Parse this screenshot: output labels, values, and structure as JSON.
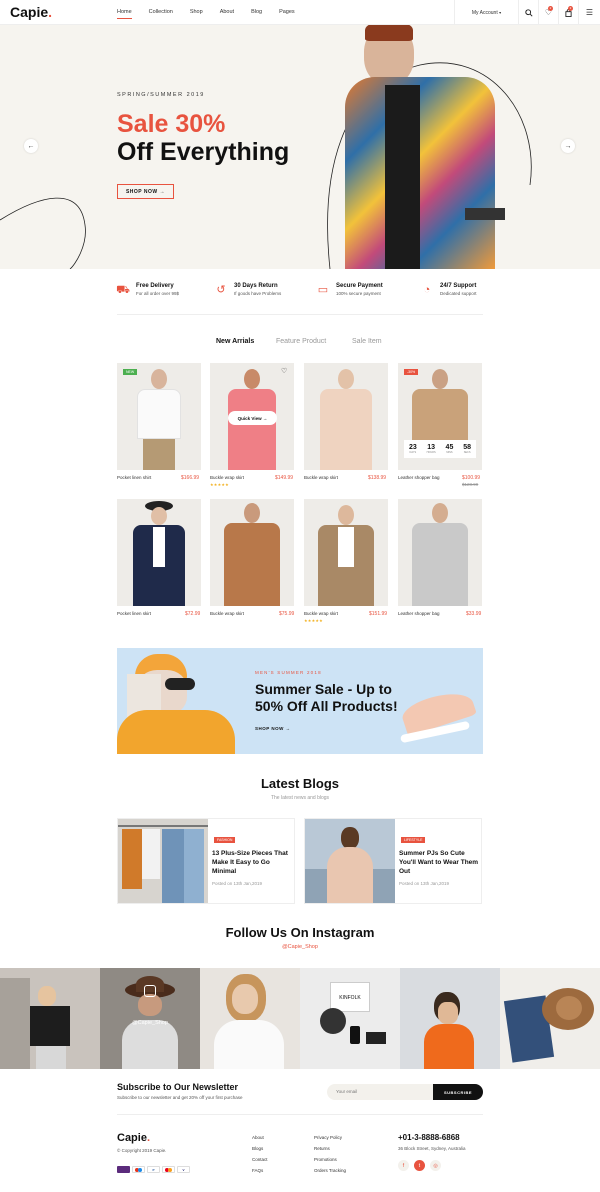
{
  "header": {
    "logo": "Capie",
    "nav": [
      "Home",
      "Collection",
      "Shop",
      "About",
      "Blog",
      "Pages"
    ],
    "account": "My Account",
    "wishlist_count": "2",
    "cart_count": "3"
  },
  "hero": {
    "subtitle": "SPRING/SUMMER 2019",
    "headline_1": "Sale 30%",
    "headline_2": "Off Everything",
    "button": "SHOP NOW →"
  },
  "features": [
    {
      "title": "Free Delivery",
      "text": "For all order over 99$"
    },
    {
      "title": "30 Days Return",
      "text": "If goods have Problems"
    },
    {
      "title": "Secure Payment",
      "text": "100% secure payment"
    },
    {
      "title": "24/7 Support",
      "text": "Dedicated support"
    }
  ],
  "tabs": [
    "New Arrials",
    "Feature Product",
    "Sale Item"
  ],
  "products": [
    {
      "name": "Pocket linen shirt",
      "price": "$166.99",
      "tag": "NEW"
    },
    {
      "name": "Buckle wrap skirt",
      "price": "$149.99",
      "quick_view": "Quick View →"
    },
    {
      "name": "Buckle wrap skirt",
      "price": "$138.99"
    },
    {
      "name": "Leather shopper bag",
      "price": "$100.99",
      "old_price": "$128.99",
      "tag": "-30%"
    },
    {
      "name": "Pocket linen skirt",
      "price": "$72.99"
    },
    {
      "name": "Buckle wrap skirt",
      "price": "$75.99"
    },
    {
      "name": "Buckle wrap skirt",
      "price": "$151.99"
    },
    {
      "name": "Leather shopper bag",
      "price": "$33.99"
    }
  ],
  "countdown": [
    {
      "value": "23",
      "unit": "DAYS"
    },
    {
      "value": "13",
      "unit": "HOURS"
    },
    {
      "value": "45",
      "unit": "MINS"
    },
    {
      "value": "58",
      "unit": "SECS"
    }
  ],
  "banner": {
    "eyebrow": "MEN'S SUMMER 2018",
    "title_1": "Summer Sale - Up to",
    "title_2": "50% Off All Products!",
    "button": "SHOP NOW →"
  },
  "blogs": {
    "title": "Latest Blogs",
    "subtitle": "The latest news and blogs",
    "posts": [
      {
        "tag": "FASHION",
        "title": "13 Plus-Size Pieces That Make It Easy to Go Minimal",
        "date": "Posted on 13th Jan,2019"
      },
      {
        "tag": "LIFESTYLE",
        "title": "Summer PJs So Cute You'll Want to Wear Them Out",
        "date": "Posted on 13th Jan,2019"
      }
    ]
  },
  "instagram": {
    "title": "Follow Us On Instagram",
    "handle": "@Capie_Shop",
    "overlay_handle": "@Capie_Shop"
  },
  "newsletter": {
    "title": "Subscribe to Our Newsletter",
    "text": "Subscribe to our newsletter and get 20% off your first purchase",
    "placeholder": "Your email",
    "button": "SUBSCRIBE"
  },
  "footer": {
    "logo": "Capie",
    "copyright": "© Copyright 2019 Capie.",
    "col1": [
      "About",
      "Blogs",
      "Contact",
      "FAQs"
    ],
    "col2": [
      "Privacy Policy",
      "Returns",
      "Promotions",
      "Orders Tracking"
    ],
    "phone": "+01-3-8888-6868",
    "address": "36 Block Street, Sydney, Australia",
    "payments": [
      "Skrill",
      "Maestro",
      "PayPal",
      "MasterCard",
      "VISA"
    ]
  }
}
